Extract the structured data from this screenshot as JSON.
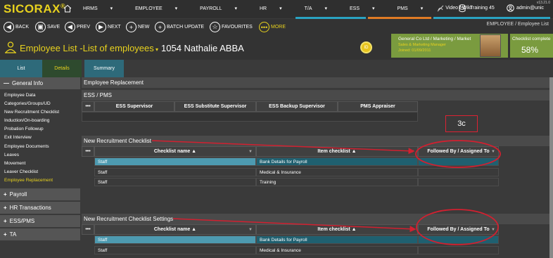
{
  "app": {
    "logo": "SICORAX",
    "logo_mark": "®",
    "version": "v13.21.0"
  },
  "nav": {
    "items": [
      {
        "label": "HRMS",
        "caret": true,
        "active": false
      },
      {
        "label": "EMPLOYEE",
        "caret": true,
        "active": true
      },
      {
        "label": "PAYROLL",
        "caret": true,
        "active": false
      },
      {
        "label": "HR",
        "caret": true,
        "active": false
      },
      {
        "label": "T/A",
        "caret": true,
        "active": false
      },
      {
        "label": "ESS",
        "caret": true,
        "active": false
      },
      {
        "label": "PMS",
        "caret": true,
        "active": false
      },
      {
        "label": "Video / Wiki",
        "caret": false,
        "active": false
      }
    ],
    "training": "Training 45",
    "user": "admin@unic"
  },
  "toolbar": {
    "back": "BACK",
    "save": "SAVE",
    "prev": "PREV",
    "next": "NEXT",
    "new": "NEW",
    "batch_update": "BATCH UPDATE",
    "favourites": "FAVOURITES",
    "more": "MORE",
    "breadcrumb": "EMPLOYEE /  Employee List"
  },
  "title": {
    "text": "Employee List -List of employees",
    "employee": "1054 Nathalie ABBA",
    "id_badge": "ID"
  },
  "company": {
    "line1": "General Co Ltd / Marketing / Market",
    "line2": "Sales & Marketing Manager",
    "line3": "Joined: 01/09/2011"
  },
  "checklist": {
    "label": "Checklist complete",
    "percent": "58%"
  },
  "tabs": {
    "list": "List",
    "details": "Details",
    "summary": "Summary"
  },
  "sidebar": {
    "general_info": "General Info",
    "items": [
      "Employee Data",
      "Categories/Groups/UD",
      "New Recruitment Checklist",
      "Induction/On-boarding",
      "Probation Followup",
      "Exit Interview",
      "Employee Documents",
      "Leaves",
      "Movement",
      "Leaver Checklist",
      "Employee Replacement"
    ],
    "payroll": "Payroll",
    "hr_transactions": "HR Transactions",
    "ess_pms": "ESS/PMS",
    "ta": "TA"
  },
  "main": {
    "employee_replacement": "Employee Replacement",
    "ess_pms": "ESS / PMS",
    "ess_cols": [
      "ESS Supervisor",
      "ESS Substitute Supervisor",
      "ESS Backup Supervisor",
      "PMS Appraiser"
    ],
    "annotation": "3c",
    "checklist_title": "New Recruitment Checklist",
    "checklist_cols": {
      "dots": "•••",
      "name": "Checklist name ▲",
      "item": "Item checklist ▲",
      "followed": "Followed By / Assigned To"
    },
    "checklist_rows": [
      {
        "name": "Staff",
        "item": "Bank Details for Payroll"
      },
      {
        "name": "Staff",
        "item": "Medical & Insurance"
      },
      {
        "name": "Staff",
        "item": "Training"
      }
    ],
    "settings_title": "New Recruitment Checklist Settings",
    "settings_rows": [
      {
        "name": "Staff",
        "item": "Bank Details for Payroll"
      },
      {
        "name": "Staff",
        "item": "Medical & Insurance"
      }
    ]
  },
  "colors": {
    "accent_yellow": "#e8d21e",
    "teal": "#2e6a7a",
    "highlight_row": "#4d9ab0",
    "annotation_red": "#d22030"
  }
}
